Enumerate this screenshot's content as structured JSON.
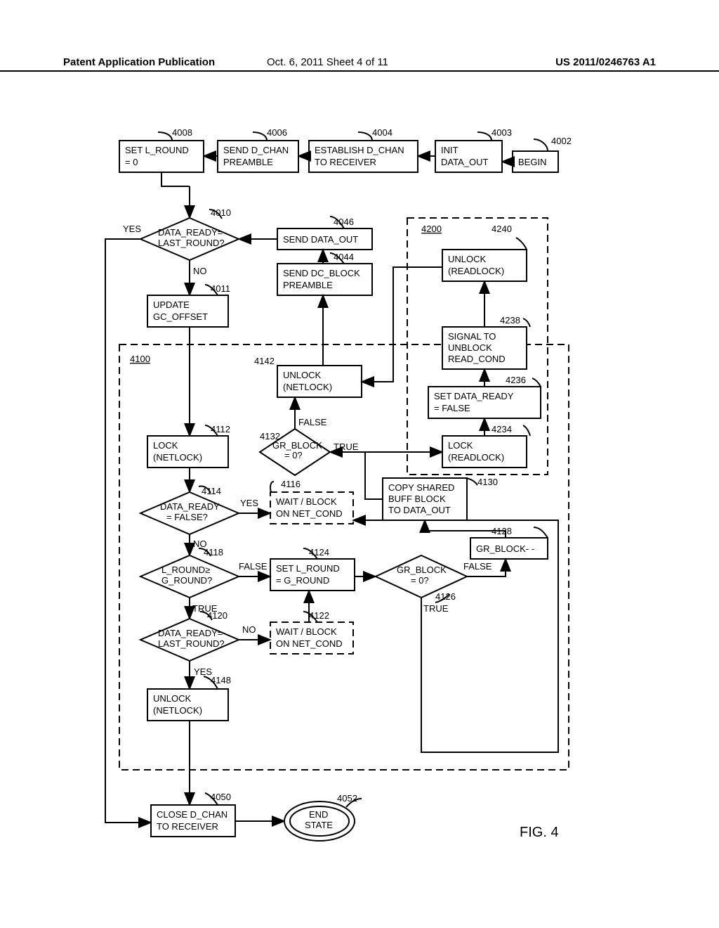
{
  "header": {
    "left": "Patent Application Publication",
    "mid": "Oct. 6, 2011   Sheet 4 of 11",
    "right": "US 2011/0246763 A1"
  },
  "refs": {
    "r4002": "4002",
    "r4003": "4003",
    "r4004": "4004",
    "r4006": "4006",
    "r4008": "4008",
    "r4010": "4010",
    "r4011": "4011",
    "r4044": "4044",
    "r4046": "4046",
    "r4050": "4050",
    "r4052": "4052",
    "r4100": "4100",
    "r4112": "4112",
    "r4114": "4114",
    "r4116": "4116",
    "r4118": "4118",
    "r4120": "4120",
    "r4122": "4122",
    "r4124": "4124",
    "r4126": "4126",
    "r4128": "4128",
    "r4130": "4130",
    "r4132": "4132",
    "r4142": "4142",
    "r4148": "4148",
    "r4200": "4200",
    "r4234": "4234",
    "r4236": "4236",
    "r4238": "4238",
    "r4240": "4240"
  },
  "nodes": {
    "begin": "BEGIN",
    "init1": "INIT",
    "init2": "DATA_OUT",
    "establish1": "ESTABLISH D_CHAN",
    "establish2": "TO RECEIVER",
    "sendpre1": "SEND D_CHAN",
    "sendpre2": "PREAMBLE",
    "setlround1": "SET L_ROUND",
    "setlround2": "= 0",
    "dec40101": "DATA_READY=",
    "dec40102": "LAST_ROUND?",
    "sendout": "SEND DATA_OUT",
    "dcblock1": "SEND DC_BLOCK",
    "dcblock2": "PREAMBLE",
    "update1": "UPDATE",
    "update2": "GC_OFFSET",
    "locknet1": "LOCK",
    "locknet2": "(NETLOCK)",
    "dec41141": "DATA_READY",
    "dec41142": "= FALSE?",
    "wait41161": "WAIT / BLOCK",
    "wait41162": "ON NET_COND",
    "dec41181": "L_ROUND≥",
    "dec41182": "G_ROUND?",
    "set41241": "SET L_ROUND",
    "set41242": "= G_ROUND",
    "dec41201": "DATA_READY=",
    "dec41202": "LAST_ROUND?",
    "wait41221": "WAIT / BLOCK",
    "wait41222": "ON NET_COND",
    "dec41261": "GR_BLOCK",
    "dec41262": "= 0?",
    "grblockmm": "GR_BLOCK- -",
    "copy1": "COPY SHARED",
    "copy2": "BUFF BLOCK",
    "copy3": "TO DATA_OUT",
    "dec41321": "GR_BLOCK",
    "dec41322": "= 0?",
    "unlocknet1": "UNLOCK",
    "unlocknet2": "(NETLOCK)",
    "lockread1": "LOCK",
    "lockread2": "(READLOCK)",
    "setfr1": "SET DATA_READY",
    "setfr2": "= FALSE",
    "signal1": "SIGNAL TO",
    "signal2": "UNBLOCK",
    "signal3": "READ_COND",
    "unlockread1": "UNLOCK",
    "unlockread2": "(READLOCK)",
    "unlocknet4148a": "UNLOCK",
    "unlocknet4148b": "(NETLOCK)",
    "close1": "CLOSE D_CHAN",
    "close2": "TO RECEIVER",
    "end1": "END",
    "end2": "STATE",
    "yes": "YES",
    "no": "NO",
    "true": "TRUE",
    "false": "FALSE"
  },
  "fig": "FIG. 4"
}
